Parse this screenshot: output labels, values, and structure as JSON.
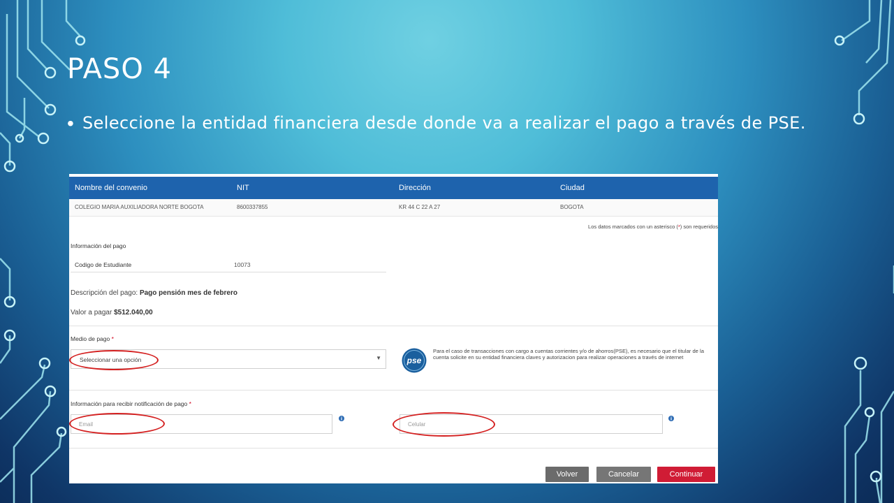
{
  "slide": {
    "title": "PASO 4",
    "bullet": "Seleccione la entidad financiera desde donde va a realizar el pago a través de PSE."
  },
  "table": {
    "headers": [
      "Nombre del convenio",
      "NIT",
      "Dirección",
      "Ciudad"
    ],
    "row": [
      "COLEGIO MARIA AUXILIADORA NORTE BOGOTA",
      "8600337855",
      "KR 44 C 22 A 27",
      "BOGOTA"
    ]
  },
  "required_note": {
    "before": "Los datos marcados con un asterisco (",
    "asterisk": "*",
    "after": ") son requeridos"
  },
  "payment_info": {
    "title": "Información del pago",
    "student_code_label": "Codigo de Estudiante",
    "student_code_value": "10073",
    "description_label": "Descripción del pago:",
    "description_value": "Pago pensión mes de febrero",
    "amount_label": "Valor a pagar",
    "amount_value": "$512.040,00"
  },
  "payment_method": {
    "title": "Medio de pago",
    "asterisk": "*",
    "selected": "Seleccionar una opción",
    "pse_logo_text": "pse",
    "pse_note": "Para el caso de transacciones con cargo a cuentas corrientes y/o de ahorros(PSE), es necesario que el titular de la cuenta solicite en su entidad financiera claves y autorizacion para realizar operaciones a través de internet"
  },
  "notification": {
    "title": "Información para recibir notificación de pago",
    "asterisk": "*",
    "email_placeholder": "Email",
    "phone_placeholder": "Celular"
  },
  "buttons": {
    "back": "Volver",
    "cancel": "Cancelar",
    "continue": "Continuar"
  },
  "colors": {
    "header_blue": "#1e63ad",
    "continue_red": "#d01c35",
    "highlight_red": "#d42020",
    "button_gray": "#6b6b6b"
  },
  "icons": [
    "info-icon",
    "pse-logo",
    "chevron-down-icon"
  ]
}
